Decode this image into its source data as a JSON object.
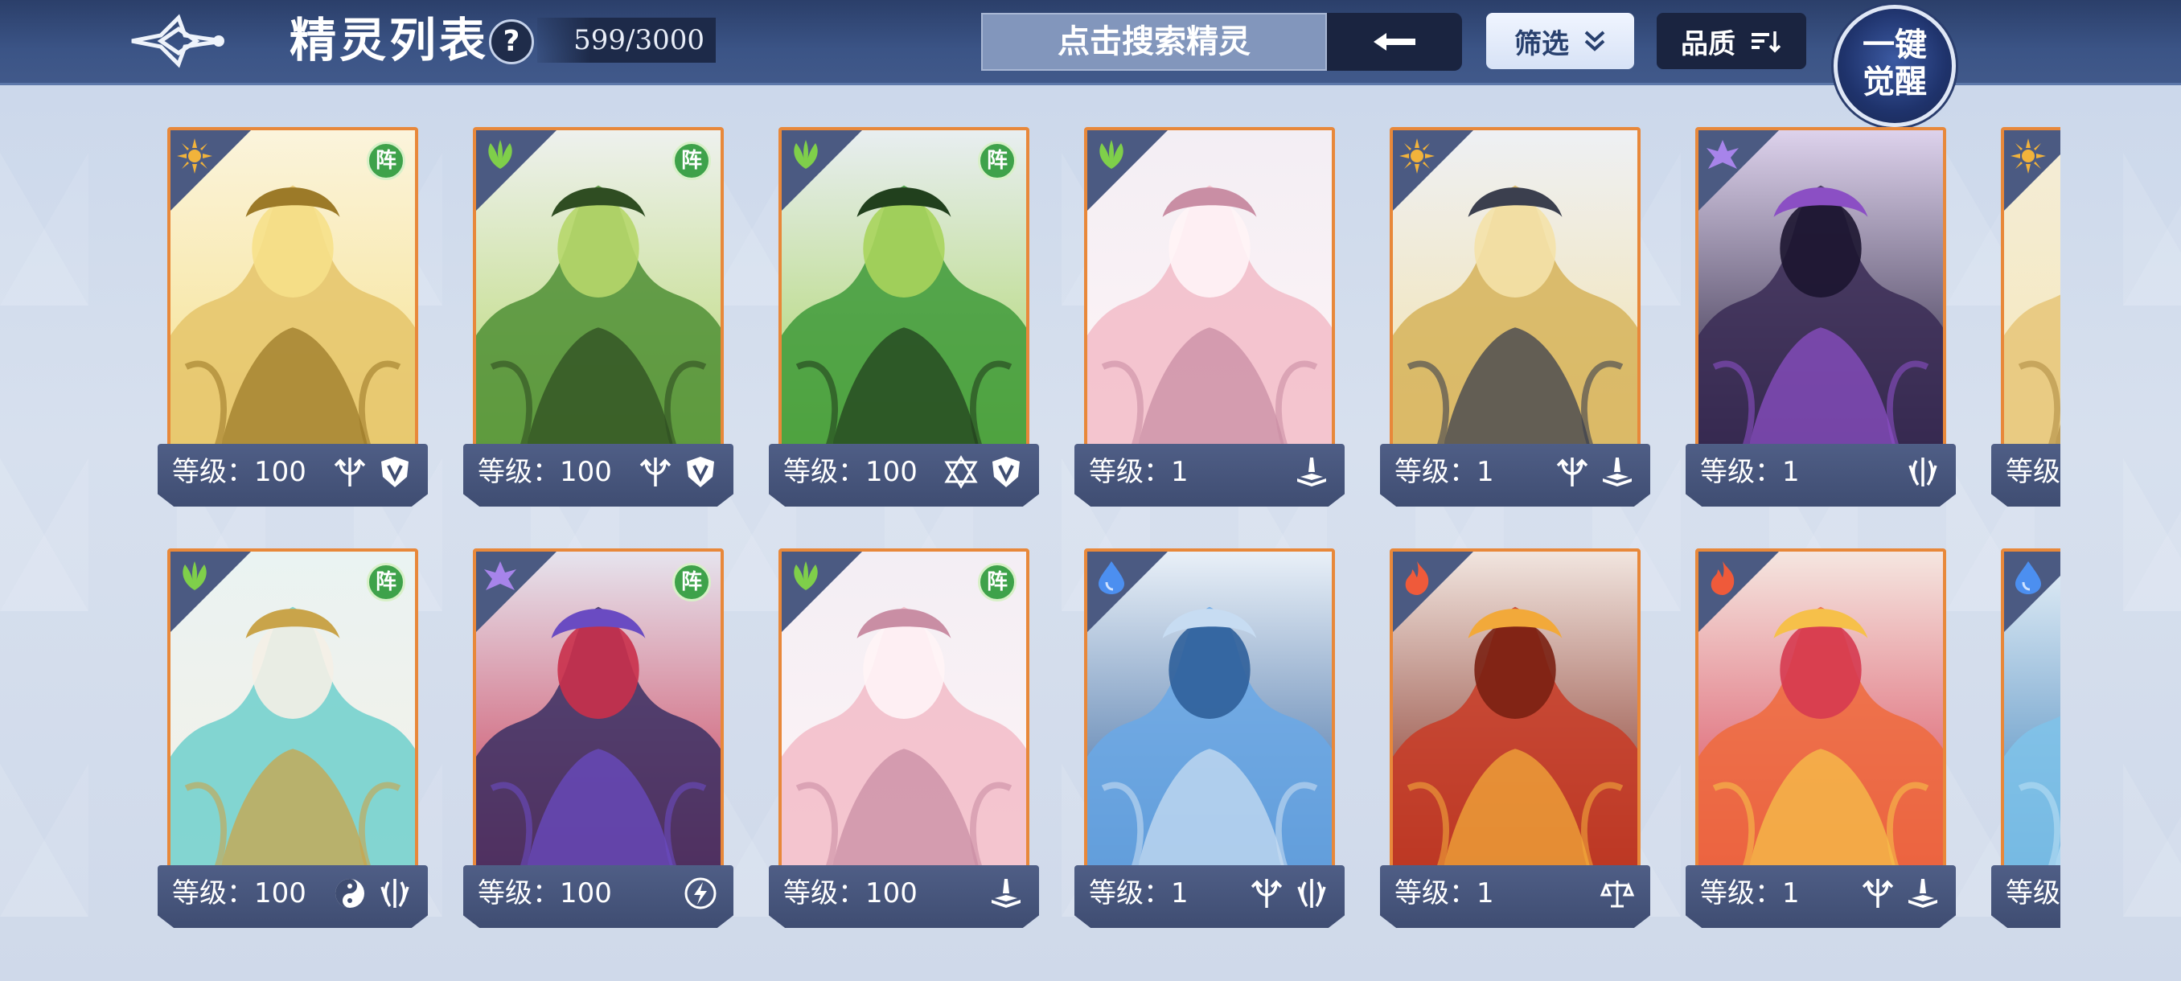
{
  "header": {
    "title": "精灵列表",
    "help_label": "?",
    "count": "599/3000",
    "search_placeholder": "点击搜索精灵",
    "filter_label": "筛选",
    "quality_label": "品质",
    "awaken_line1": "一键",
    "awaken_line2": "觉醒"
  },
  "colors": {
    "header_bg": "#3b5486",
    "card_border": "#e8883a",
    "bar_bg": "#4f5e86",
    "zhen_badge": "#3ea24a"
  },
  "cards": [
    {
      "level": "等级：100",
      "element": "light",
      "zhen": "阵",
      "skills": [
        "trident-icon",
        "shield-icon"
      ],
      "art": "gold-dragon"
    },
    {
      "level": "等级：100",
      "element": "grass",
      "zhen": "阵",
      "skills": [
        "trident-icon",
        "shield-icon"
      ],
      "art": "green-warrior"
    },
    {
      "level": "等级：100",
      "element": "grass",
      "zhen": "阵",
      "skills": [
        "hexagram-icon",
        "shield-icon"
      ],
      "art": "green-knight"
    },
    {
      "level": "等级：1",
      "element": "grass",
      "zhen": "",
      "skills": [
        "book-icon"
      ],
      "art": "pink-fairy"
    },
    {
      "level": "等级：1",
      "element": "light",
      "zhen": "",
      "skills": [
        "trident-icon",
        "book-icon"
      ],
      "art": "gold-knight"
    },
    {
      "level": "等级：1",
      "element": "shadow",
      "zhen": "",
      "skills": [
        "crest-icon"
      ],
      "art": "dark-dragon"
    },
    {
      "level": "等级：",
      "element": "light",
      "zhen": "",
      "skills": [],
      "art": "partial-gold"
    },
    {
      "level": "等级：100",
      "element": "grass",
      "zhen": "阵",
      "skills": [
        "yin-yang-icon",
        "crest-icon"
      ],
      "art": "teal-sorceress"
    },
    {
      "level": "等级：100",
      "element": "shadow",
      "zhen": "阵",
      "skills": [
        "lightning-icon"
      ],
      "art": "purple-demon"
    },
    {
      "level": "等级：100",
      "element": "grass",
      "zhen": "阵",
      "skills": [
        "book-icon"
      ],
      "art": "pink-fairy"
    },
    {
      "level": "等级：1",
      "element": "water",
      "zhen": "",
      "skills": [
        "trident-icon",
        "crest-icon"
      ],
      "art": "blue-sage"
    },
    {
      "level": "等级：1",
      "element": "fire",
      "zhen": "",
      "skills": [
        "scales-icon"
      ],
      "art": "red-dragon"
    },
    {
      "level": "等级：1",
      "element": "fire",
      "zhen": "",
      "skills": [
        "trident-icon",
        "book-icon"
      ],
      "art": "fire-lotus"
    },
    {
      "level": "等级：",
      "element": "water",
      "zhen": "",
      "skills": [],
      "art": "partial-ice"
    }
  ]
}
